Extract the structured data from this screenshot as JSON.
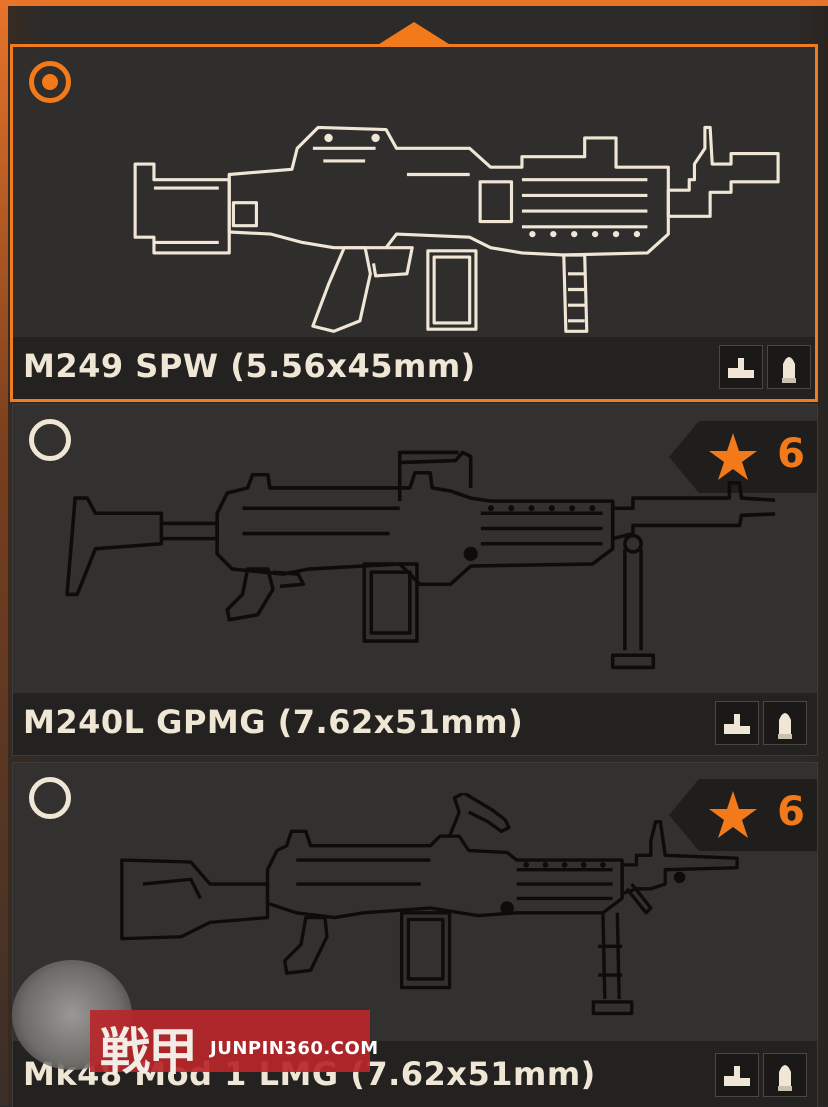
{
  "colors": {
    "accent": "#f27a1a",
    "outline_selected": "#efe6d6",
    "outline_unselected": "#0d0c0b",
    "card_bg": "#33312f",
    "name_bar_bg": "#232220"
  },
  "scroll": {
    "up_icon": "triangle-up-icon"
  },
  "weapons": [
    {
      "name": "M249 SPW (5.56x45mm)",
      "selected": true,
      "tier": null,
      "icons": [
        "stock-stat-icon",
        "ammo-stat-icon"
      ]
    },
    {
      "name": "M240L GPMG (7.62x51mm)",
      "selected": false,
      "tier": "6",
      "icons": [
        "stock-stat-icon",
        "ammo-stat-icon"
      ]
    },
    {
      "name": "Mk48 Mod 1 LMG (7.62x51mm)",
      "selected": false,
      "tier": "6",
      "icons": [
        "stock-stat-icon",
        "ammo-stat-icon"
      ]
    }
  ],
  "watermark": {
    "logo": "戦甲",
    "url": "JUNPIN360.COM"
  }
}
